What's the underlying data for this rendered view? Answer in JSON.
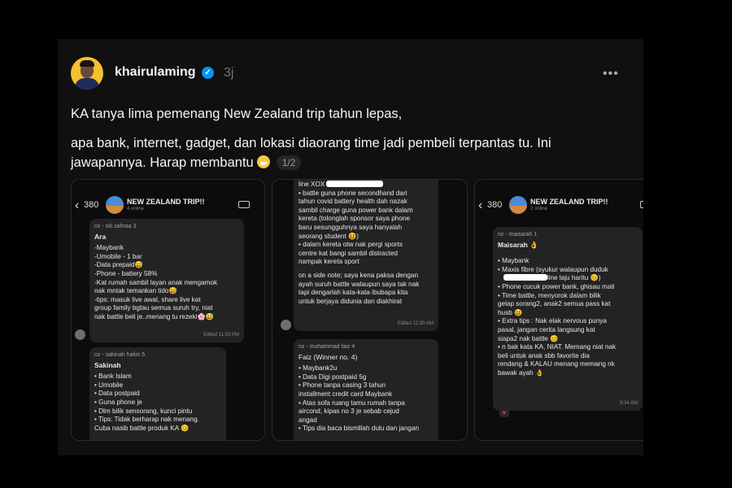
{
  "post": {
    "username": "khairulaming",
    "time": "3j",
    "more": "•••",
    "caption_line1": "KA tanya lima pemenang New Zealand trip tahun lepas,",
    "caption_line2": "apa bank, internet, gadget, dan lokasi diaorang time jadi pembeli terpantas tu. Ini",
    "caption_line3": "jawapannya. Harap membantu",
    "image_counter": "1/2"
  },
  "shot1": {
    "back_count": "380",
    "group_name": "NEW ZEALAND TRIP!!",
    "group_sub": "4 online",
    "b1": {
      "sender": "nz - siti zahraa 3",
      "name": "Ara",
      "lines": [
        "-Maybank",
        "-Umobile - 1 bar",
        "-Data prepaid😅",
        "-Phone - battery 58%",
        "-Kat rumah sambil layan anak mengamok",
        "nak mntak temankan tido😅",
        "-tips: masuk live awal, share live kat",
        "group family bgtau semua suruh try, niat",
        "nak battle beli je..menang tu rezeki🌸😅"
      ],
      "time": "Edited 11:53 PM"
    },
    "b2": {
      "sender": "nz - sakinah halim 5",
      "name": "Sakinah",
      "lines": [
        "•  Bank Islam",
        "•  Umobile",
        "•  Data postpaid",
        "•  Guna phone je",
        "•  Dlm bilik sensorang, kunci pintu",
        "•  Tips: Tidak berharap nak menang.",
        "    Cuba nasib battle produk KA 😊"
      ]
    }
  },
  "shot2": {
    "b1": {
      "first": "line XOX",
      "lines": [
        "•  battle guna phone secondhand dari",
        "   tahun covid battery health dah nazak",
        "   sambil charge guna power bank dalam",
        "   kereta (tolonglah sponsor saya phone",
        "   baru sesungguhnya saya hanyalah",
        "   seorang student 😆)",
        "•  dalam kereta otw nak pergi sports",
        "   centre kat bangi sambil distracted",
        "   nampak kereta sport",
        "",
        "on a side note; saya kena paksa dengan",
        "ayah suruh battle walaupun saya tak nak",
        "tapi dengarlah kata-kata ibubapa kita",
        "untuk berjaya didunia dan diakhirat"
      ],
      "time": "Edited 12:30 AM"
    },
    "b2": {
      "sender": "nz - muhammad faiz 4",
      "name": "Faiz (Winner no. 4)",
      "lines": [
        "•  Maybank2u",
        "•  Data Digi postpaid 5g",
        "•  Phone tanpa casing 3 tahun",
        "    installment credit card Maybank",
        "•  Atas sofa ruang tamu rumah tanpa",
        "    aircond, kipas no 3 je sebab cejud",
        "    angad",
        "•  Tips dia baca bismillah dulu dan jangan"
      ]
    }
  },
  "shot3": {
    "back_count": "380",
    "group_name": "NEW ZEALAND TRIP!!",
    "group_sub": "2 online",
    "b1": {
      "sender": "nz - maisarah 1",
      "name": "Maisarah 👌",
      "lines": [
        "•  Maybank",
        "•  Maxis fibre (syukur walaupun duduk",
        "•  Phone cucuk power bank, ghisau mati",
        "•  Time battle, menyorok dalam bilik",
        "   gelap sorang2, anak2 semua pass kat",
        "   husb 😆",
        "•  Extra tips : Nak elak nervous punya",
        "   pasal, jangan cerita langsung kat",
        "   siapa2 nak battle 😊",
        "•  n bak kata KA, NIAT. Memang niat nak",
        "   beli untuk anak sbb favorite dia",
        "   rendang & KALAU menang memang nk",
        "   bawak ayah 👌"
      ],
      "line_after_redact": "line laju haritu 😊)",
      "time": "9:34 AM"
    }
  },
  "colors": {
    "background": "#000000",
    "post": "#101010",
    "bubble": "#232323",
    "verified": "#0095f6"
  }
}
